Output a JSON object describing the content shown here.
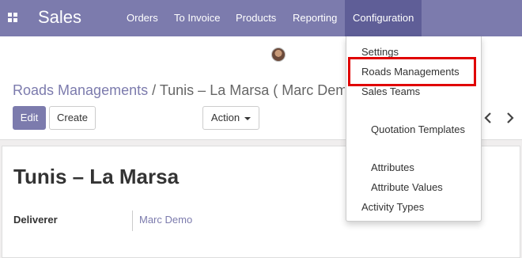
{
  "navbar": {
    "brand": "Sales",
    "menu": [
      {
        "label": "Orders"
      },
      {
        "label": "To Invoice"
      },
      {
        "label": "Products"
      },
      {
        "label": "Reporting"
      },
      {
        "label": "Configuration",
        "active": true
      }
    ],
    "bg_color": "#7c7bad",
    "active_bg_color": "#5f5e97"
  },
  "icons": {
    "apps": "grid-apps-icon",
    "prev": "chevron-left-icon",
    "next": "chevron-right-icon",
    "caret": "caret-down-icon"
  },
  "breadcrumb": {
    "parent": "Roads Managements",
    "separator": "/",
    "current": "Tunis – La Marsa ( Marc Demo )"
  },
  "buttons": {
    "edit": "Edit",
    "create": "Create",
    "action": "Action"
  },
  "record": {
    "title": "Tunis – La Marsa",
    "fields": [
      {
        "label": "Deliverer",
        "value": "Marc Demo"
      }
    ]
  },
  "config_menu": {
    "items": [
      {
        "label": "Settings",
        "indent": false
      },
      {
        "label": "Roads Managements",
        "indent": false,
        "highlighted": true
      },
      {
        "label": "Sales Teams",
        "indent": false
      },
      {
        "label": "Quotation Templates",
        "indent": true
      },
      {
        "label": "Attributes",
        "indent": true
      },
      {
        "label": "Attribute Values",
        "indent": true
      },
      {
        "label": "Activity Types",
        "indent": false
      }
    ],
    "highlight_color": "#e00000"
  }
}
